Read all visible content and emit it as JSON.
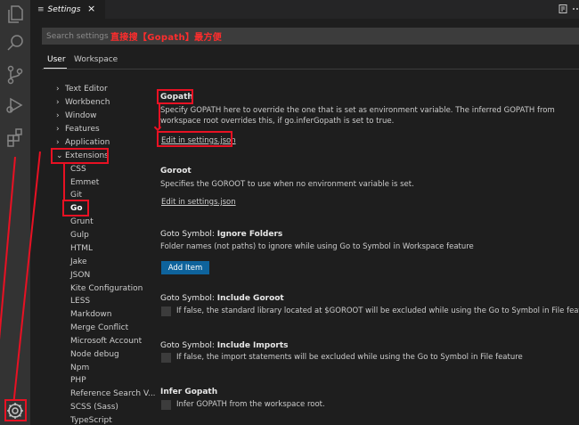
{
  "tab": {
    "title": "Settings",
    "close": "×",
    "lines": "≡"
  },
  "search": {
    "placeholder": "Search settings"
  },
  "annotation": {
    "text": "直接搜【Gopath】最方便"
  },
  "scopes": {
    "user": "User",
    "workspace": "Workspace"
  },
  "toc": {
    "collapsed": [
      "Text Editor",
      "Workbench",
      "Window",
      "Features",
      "Application"
    ],
    "extensions": "Extensions",
    "children": [
      "CSS",
      "Emmet",
      "Git",
      "Go",
      "Grunt",
      "Gulp",
      "HTML",
      "Jake",
      "JSON",
      "Kite Configuration",
      "LESS",
      "Markdown",
      "Merge Conflict",
      "Microsoft Account",
      "Node debug",
      "Npm",
      "PHP",
      "Reference Search V...",
      "SCSS (Sass)",
      "TypeScript"
    ],
    "chev_right": "›",
    "chev_down": "⌄"
  },
  "settings": {
    "gopath": {
      "title": "Gopath",
      "desc": "Specify GOPATH here to override the one that is set as environment variable. The inferred GOPATH from workspace root overrides this, if go.inferGopath is set to true.",
      "link": "Edit in settings.json"
    },
    "goroot": {
      "title": "Goroot",
      "desc": "Specifies the GOROOT to use when no environment variable is set.",
      "link": "Edit in settings.json"
    },
    "ignore_folders": {
      "prefix": "Goto Symbol: ",
      "name": "Ignore Folders",
      "desc": "Folder names (not paths) to ignore while using Go to Symbol in Workspace feature",
      "button": "Add Item"
    },
    "include_goroot": {
      "prefix": "Goto Symbol: ",
      "name": "Include Goroot",
      "desc": "If false, the standard library located at $GOROOT will be excluded while using the Go to Symbol in File feature"
    },
    "include_imports": {
      "prefix": "Goto Symbol: ",
      "name": "Include Imports",
      "desc": "If false, the import statements will be excluded while using the Go to Symbol in File feature"
    },
    "infer_gopath": {
      "title": "Infer Gopath",
      "desc": "Infer GOPATH from the workspace root."
    }
  }
}
